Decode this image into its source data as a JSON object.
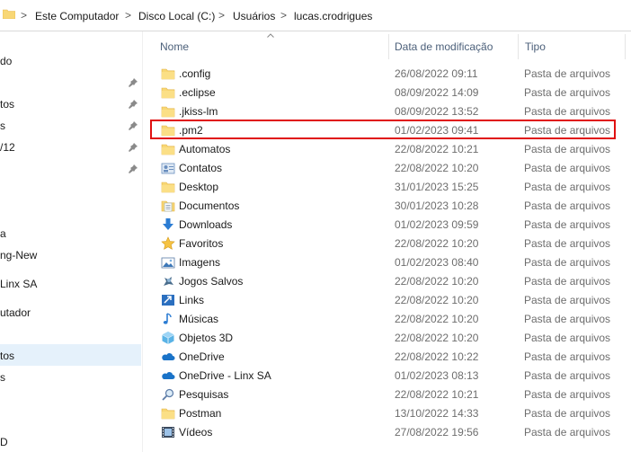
{
  "address_bar": {
    "crumbs": [
      "Este Computador",
      "Disco Local (C:)",
      "Usuários",
      "lucas.crodrigues"
    ],
    "separator": ">"
  },
  "nav_pane": {
    "items": [
      "do",
      "tos",
      "s",
      "/12",
      "a",
      "ng-New",
      "Linx SA",
      "utador",
      "tos",
      "s",
      "D"
    ]
  },
  "columns": {
    "name": "Nome",
    "date": "Data de modificação",
    "type": "Tipo"
  },
  "files": [
    {
      "name": ".config",
      "date": "26/08/2022 09:11",
      "type": "Pasta de arquivos",
      "icon": "folder-icon"
    },
    {
      "name": ".eclipse",
      "date": "08/09/2022 14:09",
      "type": "Pasta de arquivos",
      "icon": "folder-icon"
    },
    {
      "name": ".jkiss-lm",
      "date": "08/09/2022 13:52",
      "type": "Pasta de arquivos",
      "icon": "folder-icon"
    },
    {
      "name": ".pm2",
      "date": "01/02/2023 09:41",
      "type": "Pasta de arquivos",
      "icon": "folder-icon"
    },
    {
      "name": "Automatos",
      "date": "22/08/2022 10:21",
      "type": "Pasta de arquivos",
      "icon": "folder-icon"
    },
    {
      "name": "Contatos",
      "date": "22/08/2022 10:20",
      "type": "Pasta de arquivos",
      "icon": "contacts-icon"
    },
    {
      "name": "Desktop",
      "date": "31/01/2023 15:25",
      "type": "Pasta de arquivos",
      "icon": "folder-icon"
    },
    {
      "name": "Documentos",
      "date": "30/01/2023 10:28",
      "type": "Pasta de arquivos",
      "icon": "documents-icon"
    },
    {
      "name": "Downloads",
      "date": "01/02/2023 09:59",
      "type": "Pasta de arquivos",
      "icon": "download-icon"
    },
    {
      "name": "Favoritos",
      "date": "22/08/2022 10:20",
      "type": "Pasta de arquivos",
      "icon": "star-icon"
    },
    {
      "name": "Imagens",
      "date": "01/02/2023 08:40",
      "type": "Pasta de arquivos",
      "icon": "pictures-icon"
    },
    {
      "name": "Jogos Salvos",
      "date": "22/08/2022 10:20",
      "type": "Pasta de arquivos",
      "icon": "saved-games-icon"
    },
    {
      "name": "Links",
      "date": "22/08/2022 10:20",
      "type": "Pasta de arquivos",
      "icon": "links-icon"
    },
    {
      "name": "Músicas",
      "date": "22/08/2022 10:20",
      "type": "Pasta de arquivos",
      "icon": "music-icon"
    },
    {
      "name": "Objetos 3D",
      "date": "22/08/2022 10:20",
      "type": "Pasta de arquivos",
      "icon": "3d-objects-icon"
    },
    {
      "name": "OneDrive",
      "date": "22/08/2022 10:22",
      "type": "Pasta de arquivos",
      "icon": "onedrive-icon"
    },
    {
      "name": "OneDrive - Linx SA",
      "date": "01/02/2023 08:13",
      "type": "Pasta de arquivos",
      "icon": "onedrive-icon"
    },
    {
      "name": "Pesquisas",
      "date": "22/08/2022 10:21",
      "type": "Pasta de arquivos",
      "icon": "search-icon"
    },
    {
      "name": "Postman",
      "date": "13/10/2022 14:33",
      "type": "Pasta de arquivos",
      "icon": "folder-icon"
    },
    {
      "name": "Vídeos",
      "date": "27/08/2022 19:56",
      "type": "Pasta de arquivos",
      "icon": "videos-icon"
    }
  ],
  "colors": {
    "folder": "#f8d775",
    "folder_dark": "#e8b84a",
    "highlight": "#e01010",
    "selection": "#e5f1fb",
    "header_text": "#4c607a"
  }
}
